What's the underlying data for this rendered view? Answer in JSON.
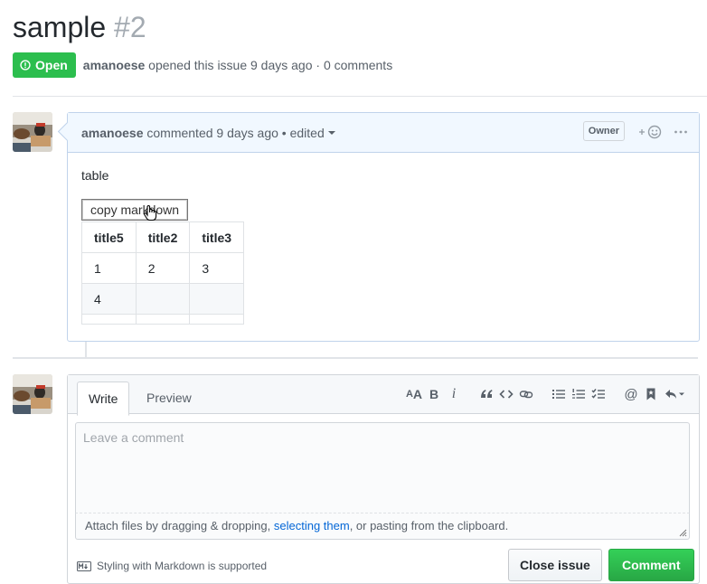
{
  "issue": {
    "title": "sample",
    "number": "#2",
    "state": "Open",
    "author": "amanoese",
    "opened_text": "opened this issue 9 days ago · 0 comments"
  },
  "comment": {
    "author": "amanoese",
    "meta": "commented 9 days ago • edited",
    "owner_badge": "Owner",
    "body_text": "table",
    "copy_button": "copy markdown",
    "table": {
      "headers": [
        "title5",
        "title2",
        "title3"
      ],
      "rows": [
        [
          "1",
          "2",
          "3"
        ],
        [
          "4",
          "",
          ""
        ]
      ]
    }
  },
  "form": {
    "tabs": [
      "Write",
      "Preview"
    ],
    "placeholder": "Leave a comment",
    "attach_prefix": "Attach files by dragging & dropping, ",
    "attach_link": "selecting them",
    "attach_suffix": ", or pasting from the clipboard.",
    "markdown_hint": "Styling with Markdown is supported",
    "close_button": "Close issue",
    "comment_button": "Comment"
  },
  "colors": {
    "open_green": "#2cbe4e",
    "link_blue": "#0366d6",
    "comment_header_bg": "#f1f8ff"
  }
}
